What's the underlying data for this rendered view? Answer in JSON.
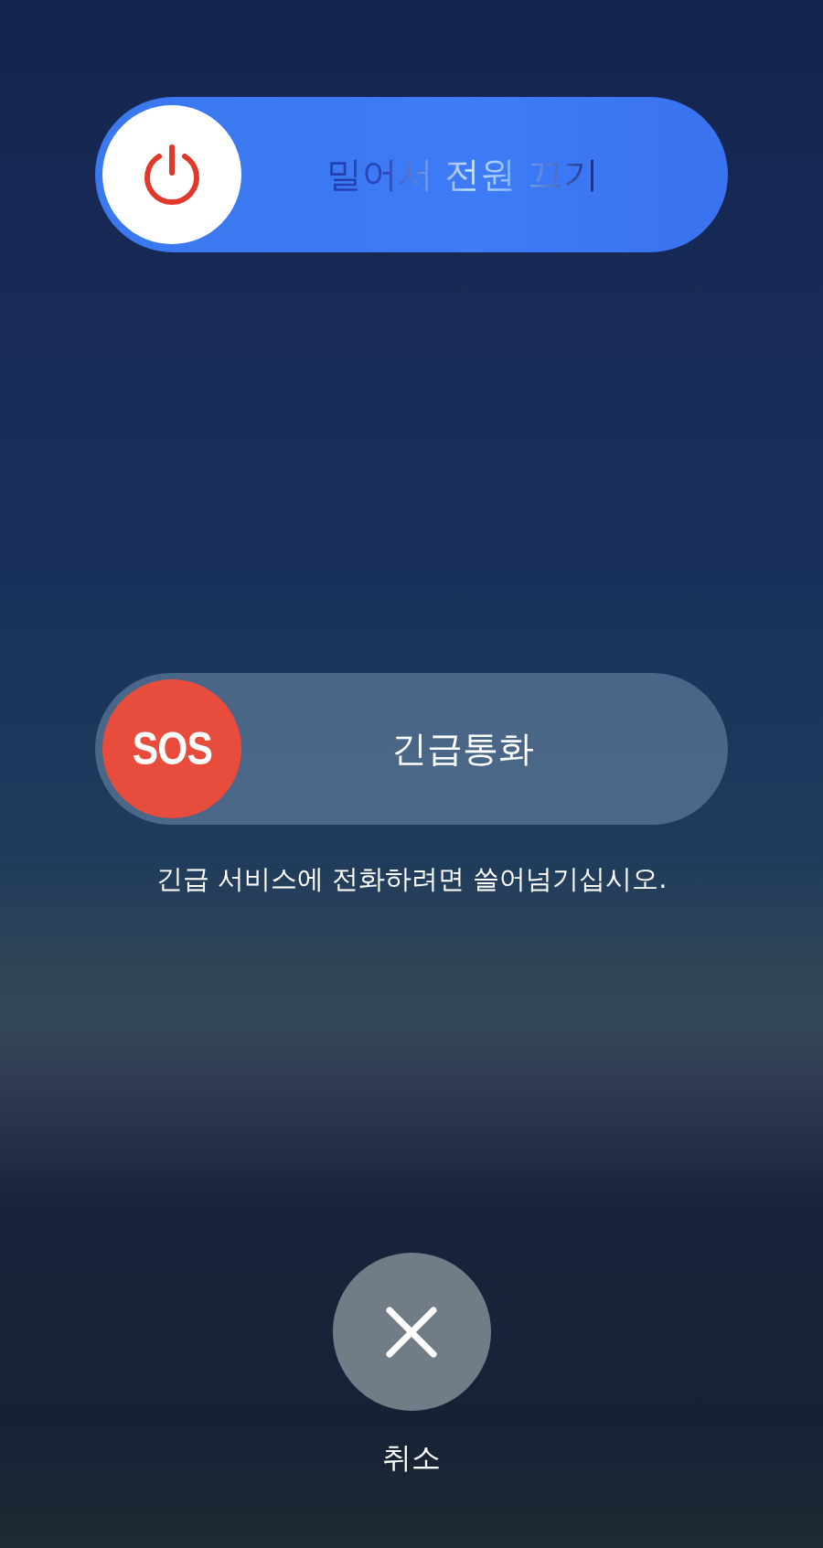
{
  "power_slider": {
    "label": "밀어서 전원 끄기",
    "level": 0
  },
  "emergency_slider": {
    "badge": "SOS",
    "label": "긴급통화",
    "level": 0
  },
  "emergency_hint": "긴급 서비스에 전화하려면 쓸어넘기십시오.",
  "cancel_button": {
    "label": "취소"
  }
}
